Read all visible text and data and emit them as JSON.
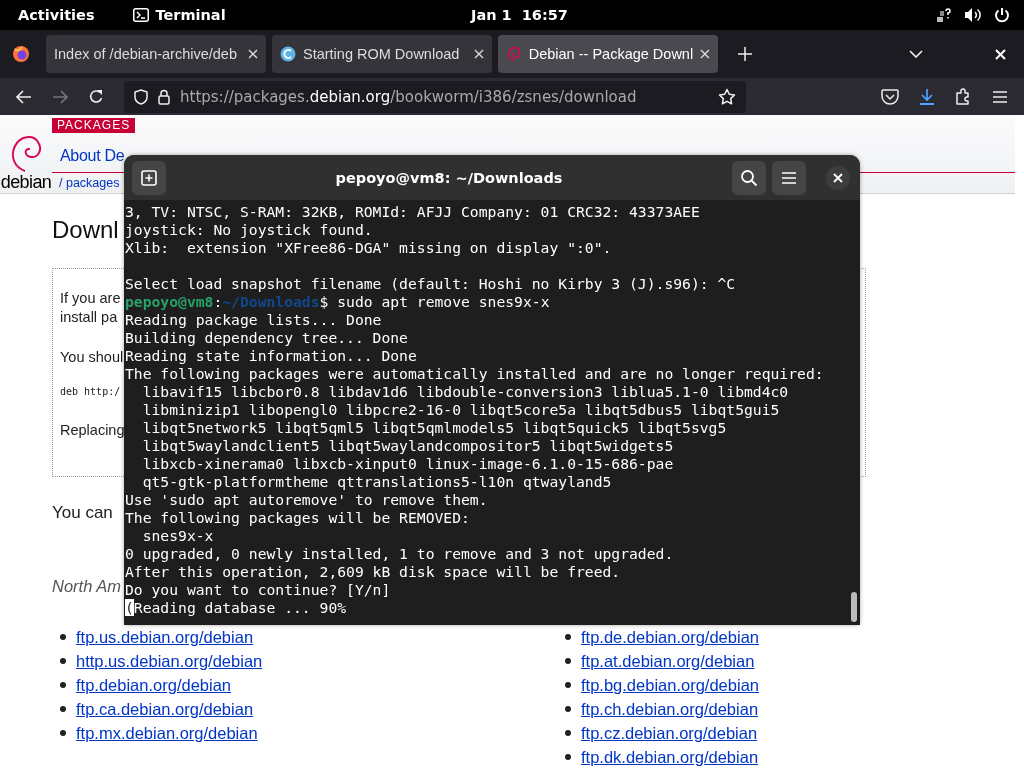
{
  "top_bar": {
    "activities": "Activities",
    "app": "Terminal",
    "clock": "Jan 1  16:57"
  },
  "browser": {
    "tabs": [
      {
        "kind": "plain",
        "title": "Index of /debian-archive/deb",
        "selected": false
      },
      {
        "kind": "site",
        "title": "Starting ROM Download",
        "selected": false
      },
      {
        "kind": "debian",
        "title": "Debian -- Package Downl",
        "selected": true
      }
    ],
    "url": {
      "prefix": "https://packages.",
      "domain": "debian.org",
      "path": "/bookworm/i386/zsnes/download"
    }
  },
  "page": {
    "logo": "debian",
    "badge": "PACKAGES",
    "nav": "About De",
    "breadcrumb": "/ packages",
    "heading": "Downl",
    "notice": [
      {
        "kind": "text",
        "text": "If you are\ninstall pa"
      },
      {
        "kind": "text",
        "text": "You shoul"
      },
      {
        "kind": "code",
        "text": "deb http:/"
      },
      {
        "kind": "text",
        "text": "Replacing"
      }
    ],
    "intro": "You can",
    "region": "North Am",
    "links_left": [
      "ftp.us.debian.org/debian",
      "http.us.debian.org/debian",
      "ftp.debian.org/debian",
      "ftp.ca.debian.org/debian",
      "ftp.mx.debian.org/debian"
    ],
    "links_right": [
      "ftp.de.debian.org/debian",
      "ftp.at.debian.org/debian",
      "ftp.bg.debian.org/debian",
      "ftp.ch.debian.org/debian",
      "ftp.cz.debian.org/debian",
      "ftp.dk.debian.org/debian"
    ]
  },
  "terminal": {
    "title": "pepoyo@vm8: ~/Downloads",
    "lines": [
      {
        "kind": "output",
        "text": "3, TV: NTSC, S-RAM: 32KB, ROMId: AFJJ Company: 01 CRC32: 43373AEE"
      },
      {
        "kind": "output",
        "text": "joystick: No joystick found."
      },
      {
        "kind": "output",
        "text": "Xlib:  extension \"XFree86-DGA\" missing on display \":0\"."
      },
      {
        "kind": "blank"
      },
      {
        "kind": "output",
        "text": "Select load snapshot filename (default: Hoshi no Kirby 3 (J).s96): ^C"
      },
      {
        "kind": "prompt",
        "user": "pepoyo@vm8",
        "sep": ":",
        "path": "~/Downloads",
        "command": "$ sudo apt remove snes9x-x"
      },
      {
        "kind": "output",
        "text": "Reading package lists... Done"
      },
      {
        "kind": "output",
        "text": "Building dependency tree... Done"
      },
      {
        "kind": "output",
        "text": "Reading state information... Done"
      },
      {
        "kind": "output",
        "text": "The following packages were automatically installed and are no longer required:"
      },
      {
        "kind": "output",
        "text": "  libavif15 libcbor0.8 libdav1d6 libdouble-conversion3 liblua5.1-0 libmd4c0"
      },
      {
        "kind": "output",
        "text": "  libminizip1 libopengl0 libpcre2-16-0 libqt5core5a libqt5dbus5 libqt5gui5"
      },
      {
        "kind": "output",
        "text": "  libqt5network5 libqt5qml5 libqt5qmlmodels5 libqt5quick5 libqt5svg5"
      },
      {
        "kind": "output",
        "text": "  libqt5waylandclient5 libqt5waylandcompositor5 libqt5widgets5"
      },
      {
        "kind": "output",
        "text": "  libxcb-xinerama0 libxcb-xinput0 linux-image-6.1.0-15-686-pae"
      },
      {
        "kind": "output",
        "text": "  qt5-gtk-platformtheme qttranslations5-l10n qtwayland5"
      },
      {
        "kind": "output",
        "text": "Use 'sudo apt autoremove' to remove them."
      },
      {
        "kind": "output",
        "text": "The following packages will be REMOVED:"
      },
      {
        "kind": "output",
        "text": "  snes9x-x"
      },
      {
        "kind": "output",
        "text": "0 upgraded, 0 newly installed, 1 to remove and 3 not upgraded."
      },
      {
        "kind": "output",
        "text": "After this operation, 2,609 kB disk space will be freed."
      },
      {
        "kind": "output",
        "text": "Do you want to continue? [Y/n]"
      },
      {
        "kind": "cursor",
        "cursor": "(",
        "text": "Reading database ... 90%"
      }
    ]
  }
}
